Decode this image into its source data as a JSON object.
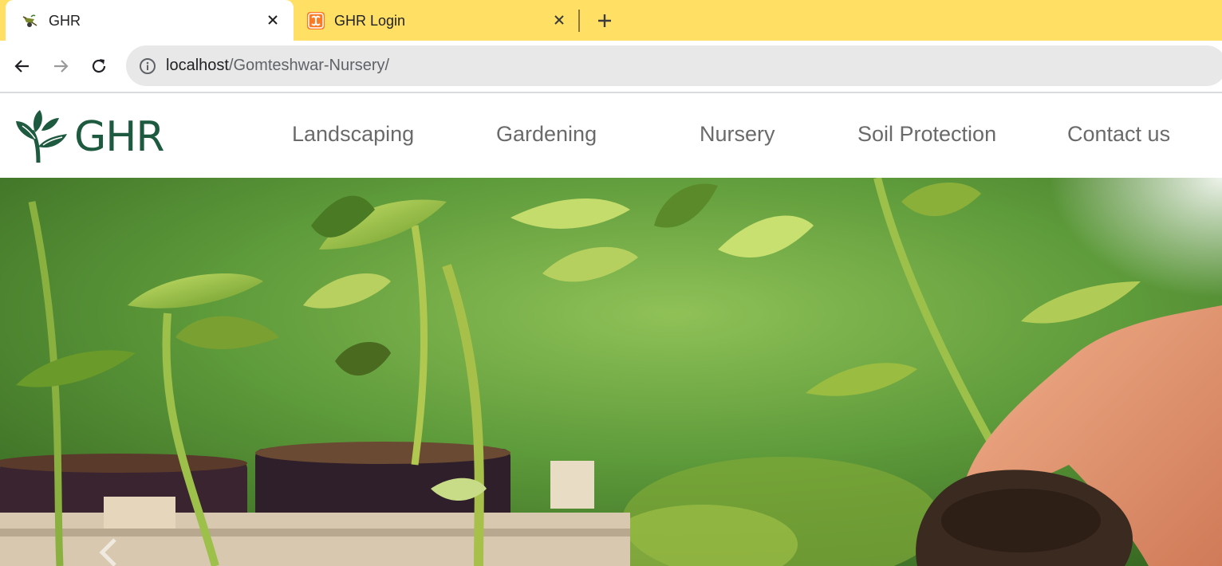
{
  "browser": {
    "tabs": [
      {
        "title": "GHR",
        "favicon": "wheelbarrow-icon",
        "active": true
      },
      {
        "title": "GHR Login",
        "favicon": "xampp-icon",
        "active": false
      }
    ],
    "url": {
      "host": "localhost",
      "path": "/Gomteshwar-Nursery/"
    },
    "colors": {
      "tabstrip": "#ffe064",
      "omnibox": "#e8e8e8"
    }
  },
  "site": {
    "logo_text": "GHR",
    "brand_color": "#1d5a3f",
    "menu": [
      "Landscaping",
      "Gardening",
      "Nursery",
      "Soil Protection",
      "Contact us"
    ]
  },
  "hero": {
    "description_icon": "chevron-left-icon"
  }
}
